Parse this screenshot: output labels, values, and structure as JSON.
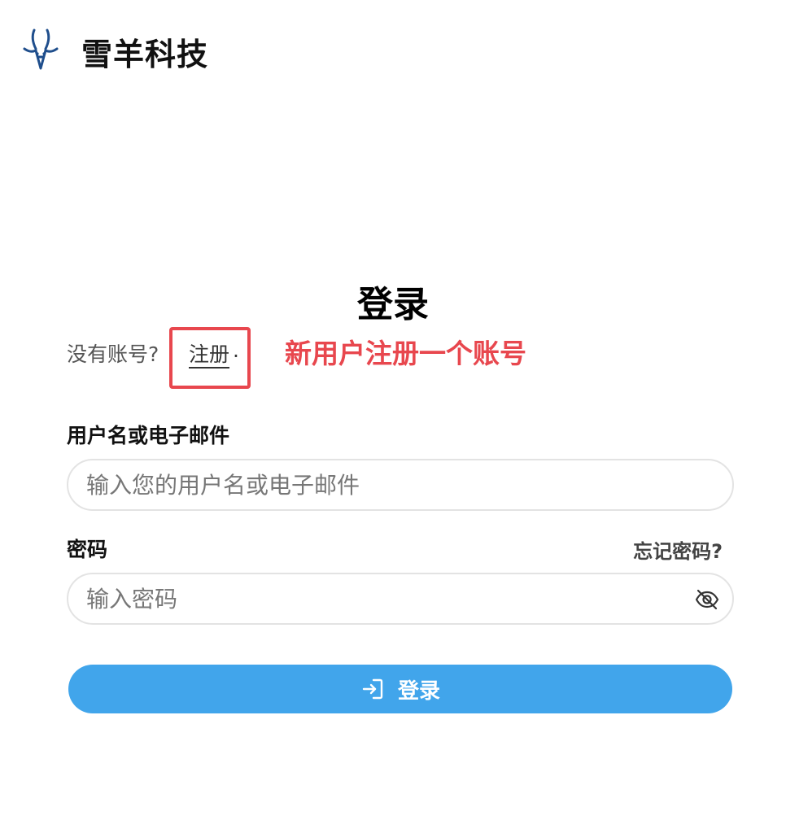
{
  "brand": {
    "name": "雪羊科技",
    "logo_icon": "antelope-logo-icon",
    "logo_color": "#1f4e8c"
  },
  "login": {
    "title": "登录",
    "no_account_text": "没有账号?",
    "register_link": "注册",
    "register_suffix": ".",
    "annotation": "新用户注册一个账号",
    "annotation_color": "#e8474e"
  },
  "form": {
    "username": {
      "label": "用户名或电子邮件",
      "placeholder": "输入您的用户名或电子邮件",
      "value": ""
    },
    "password": {
      "label": "密码",
      "placeholder": "输入密码",
      "value": "",
      "toggle_icon": "eye-off-icon"
    },
    "forgot_password": "忘记密码?",
    "submit": {
      "label": "登录",
      "icon": "sign-in-icon",
      "color": "#41a5eb"
    }
  }
}
